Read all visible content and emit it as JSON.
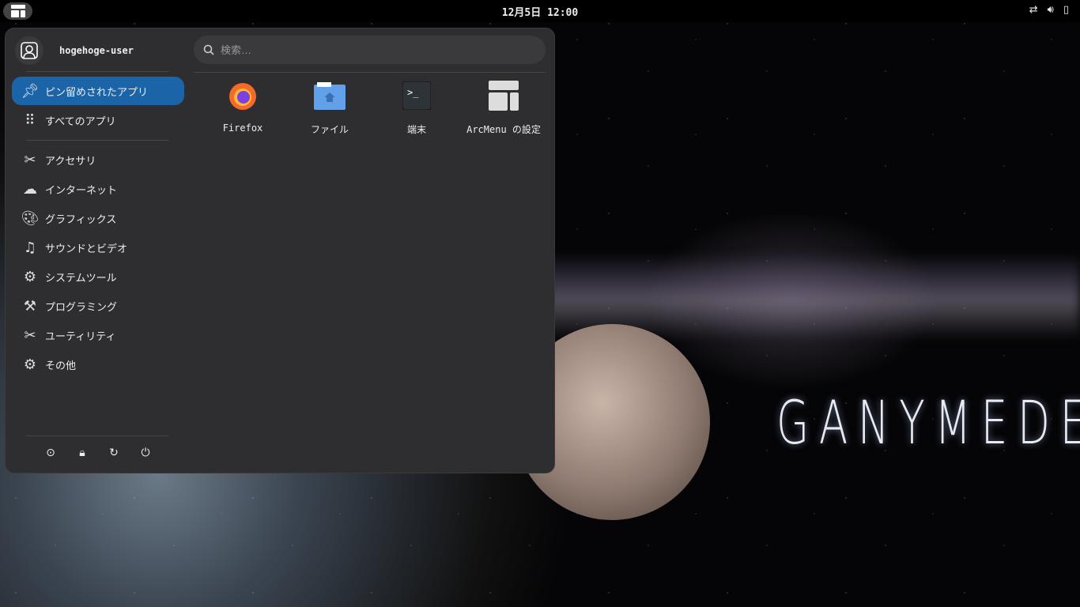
{
  "topbar": {
    "clock": "12月5日 12:00",
    "tray": [
      "network-icon",
      "volume-icon",
      "battery-icon"
    ]
  },
  "wallpaper": {
    "title": "GANYMEDE"
  },
  "menu": {
    "user": "hogehoge-user",
    "search_placeholder": "検索…",
    "categories": [
      {
        "label": "ピン留めされたアプリ",
        "icon": "pin-icon",
        "active": true
      },
      {
        "label": "すべてのアプリ",
        "icon": "grid-icon"
      },
      {
        "label": "アクセサリ",
        "icon": "accessories-icon"
      },
      {
        "label": "インターネット",
        "icon": "cloud-icon"
      },
      {
        "label": "グラフィックス",
        "icon": "palette-icon"
      },
      {
        "label": "サウンドとビデオ",
        "icon": "multimedia-icon"
      },
      {
        "label": "システムツール",
        "icon": "gear-icon"
      },
      {
        "label": "プログラミング",
        "icon": "hammer-icon"
      },
      {
        "label": "ユーティリティ",
        "icon": "utilities-icon"
      },
      {
        "label": "その他",
        "icon": "other-icon"
      }
    ],
    "apps": [
      {
        "label": "Firefox",
        "icon": "firefox-icon"
      },
      {
        "label": "ファイル",
        "icon": "folder-icon"
      },
      {
        "label": "端末",
        "icon": "terminal-icon"
      },
      {
        "label": "ArcMenu の設定",
        "icon": "arcmenu-icon"
      }
    ],
    "actions": [
      "logout-icon",
      "lock-icon",
      "restart-icon",
      "power-icon"
    ]
  }
}
